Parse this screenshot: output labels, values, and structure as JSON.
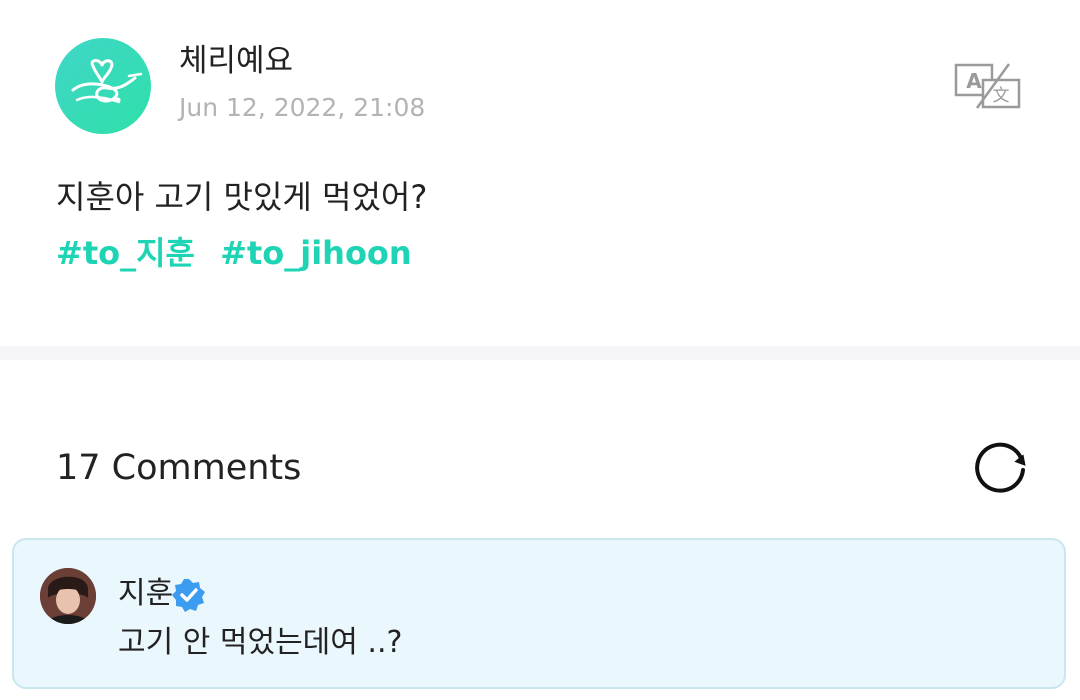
{
  "post": {
    "author_name": "체리예요",
    "date": "Jun 12, 2022, 21:08",
    "body": "지훈아 고기 맛있게 먹었어?",
    "hashtags": [
      "#to_지훈",
      "#to_jihoon"
    ],
    "icons": {
      "avatar": "cherry-logo-avatar",
      "translate": "translate-icon"
    }
  },
  "comments": {
    "count_label": "17 Comments",
    "refresh_icon": "refresh-icon",
    "items": [
      {
        "name": "지훈",
        "verified": true,
        "text": "고기 안 먹었는데여 ..?"
      }
    ]
  },
  "colors": {
    "accent": "#1fd4b4",
    "date_gray": "#b3b3b3",
    "comment_bg": "#eaf7fc",
    "comment_border": "#c9e7ee",
    "verified_blue": "#3b9cf0"
  }
}
